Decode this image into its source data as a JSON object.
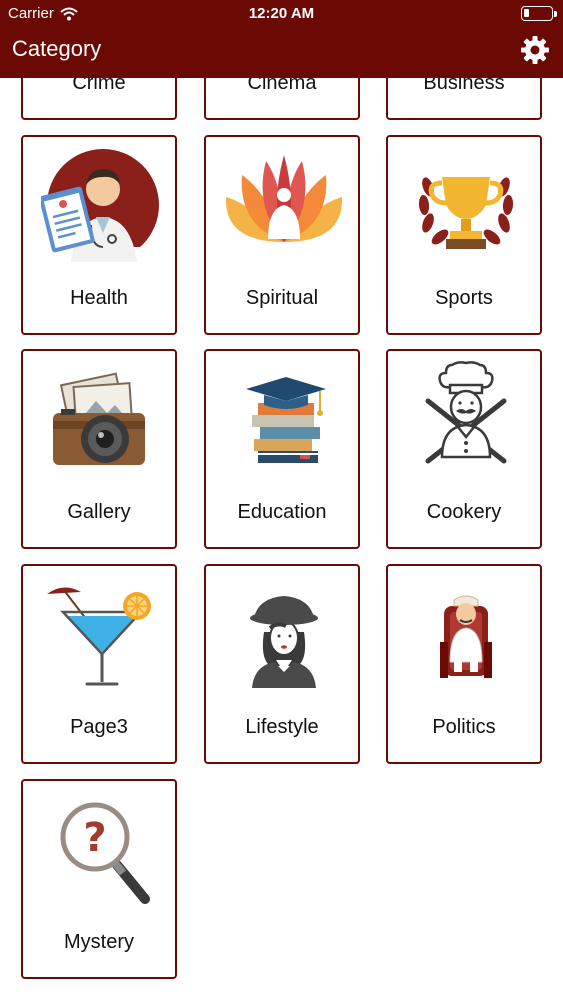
{
  "status_bar": {
    "carrier": "Carrier",
    "time": "12:20 AM"
  },
  "nav": {
    "title": "Category",
    "settings_icon": "gear-icon"
  },
  "theme": {
    "accent": "#6b0a05"
  },
  "categories": [
    {
      "label": "Crime",
      "icon": "crime-icon"
    },
    {
      "label": "Cinema",
      "icon": "cinema-icon"
    },
    {
      "label": "Business",
      "icon": "business-icon"
    },
    {
      "label": "Health",
      "icon": "doctor-icon"
    },
    {
      "label": "Spiritual",
      "icon": "lotus-icon"
    },
    {
      "label": "Sports",
      "icon": "trophy-icon"
    },
    {
      "label": "Gallery",
      "icon": "camera-photos-icon"
    },
    {
      "label": "Education",
      "icon": "books-graduation-cap-icon"
    },
    {
      "label": "Cookery",
      "icon": "chef-icon"
    },
    {
      "label": "Page3",
      "icon": "cocktail-icon"
    },
    {
      "label": "Lifestyle",
      "icon": "woman-hat-icon"
    },
    {
      "label": "Politics",
      "icon": "politician-chair-icon"
    },
    {
      "label": "Mystery",
      "icon": "magnifier-question-icon"
    }
  ]
}
